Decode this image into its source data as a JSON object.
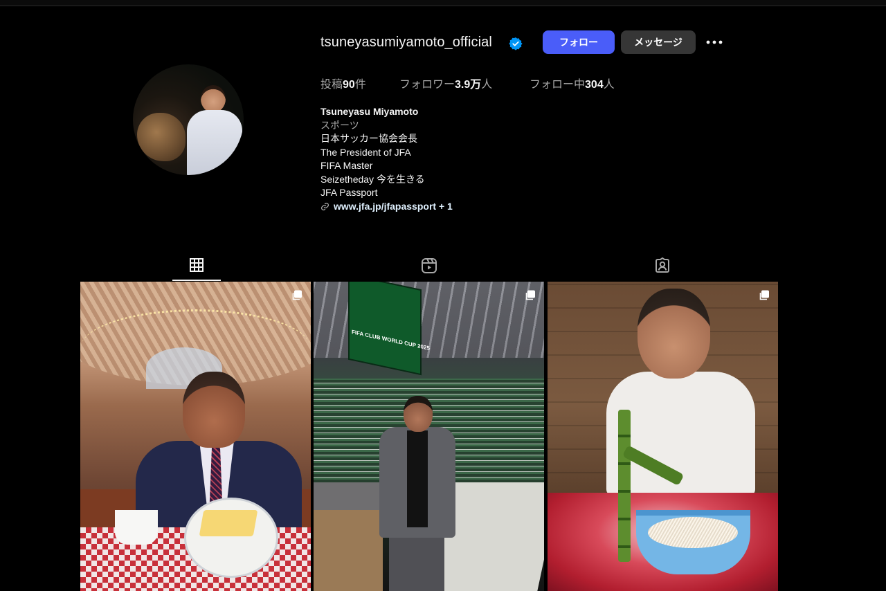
{
  "profile": {
    "username": "tsuneyasumiyamoto_official",
    "verified_icon": "verified-badge-icon",
    "buttons": {
      "follow": "フォロー",
      "message": "メッセージ",
      "more_icon": "more-options-icon"
    },
    "stats": {
      "posts_label": "投稿",
      "posts_count": "90",
      "posts_suffix": "件",
      "followers_label": "フォロワー",
      "followers_count": "3.9万",
      "followers_suffix": "人",
      "following_label": "フォロー中",
      "following_count": "304",
      "following_suffix": "人"
    },
    "bio": {
      "name": "Tsuneyasu Miyamoto",
      "category": "スポーツ",
      "lines": [
        "日本サッカー協会会長",
        "The President of JFA",
        "FIFA Master",
        "Seizetheday 今を生きる",
        "JFA Passport"
      ],
      "link": "www.jfa.jp/jfapassport + 1"
    }
  },
  "tabs": [
    {
      "icon": "grid-icon",
      "active": true
    },
    {
      "icon": "reels-icon",
      "active": false
    },
    {
      "icon": "tagged-icon",
      "active": false
    }
  ],
  "posts": [
    {
      "kind": "photo",
      "multi": true
    },
    {
      "kind": "photo",
      "multi": true,
      "overlay_text": "FIFA CLUB WORLD CUP 2025"
    },
    {
      "kind": "photo",
      "multi": true
    }
  ],
  "colors": {
    "background": "#000000",
    "follow_button": "#4a5df9",
    "message_button": "#363636",
    "verified": "#0095f6",
    "muted_text": "#a8a8a8"
  }
}
